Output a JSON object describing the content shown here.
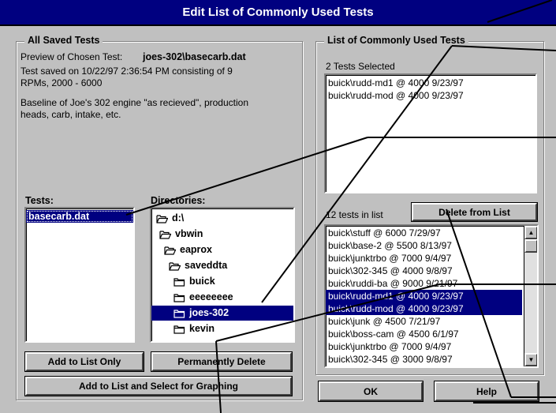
{
  "dialog": {
    "title": "Edit List of Commonly Used Tests"
  },
  "saved_tests": {
    "group_title": "All Saved Tests",
    "preview_prefix": "Preview of Chosen Test:",
    "preview_name": "joes-302\\basecarb.dat",
    "saved_line1": "Test saved on 10/22/97 2:36:54 PM consisting of 9",
    "saved_line2": "RPMs, 2000 - 6000",
    "desc_line1": "Baseline of Joe's 302 engine \"as recieved\", production",
    "desc_line2": "heads, carb, intake, etc.",
    "tests_label": "Tests:",
    "tests": [
      {
        "label": "basecarb.dat",
        "selected": true
      }
    ],
    "directories_label": "Directories:",
    "directories": [
      {
        "label": "d:\\",
        "icon": "folder-open-icon",
        "selected": false
      },
      {
        "label": "vbwin",
        "icon": "folder-open-icon",
        "selected": false
      },
      {
        "label": "eaprox",
        "icon": "folder-open-icon",
        "selected": false
      },
      {
        "label": "saveddta",
        "icon": "folder-open-icon",
        "selected": false
      },
      {
        "label": "buick",
        "icon": "folder-icon",
        "selected": false
      },
      {
        "label": "eeeeeeee",
        "icon": "folder-icon",
        "selected": false
      },
      {
        "label": "joes-302",
        "icon": "folder-icon",
        "selected": true
      },
      {
        "label": "kevin",
        "icon": "folder-icon",
        "selected": false
      }
    ],
    "add_only_label": "Add to List Only",
    "permanently_delete_label": "Permanently Delete",
    "add_select_label": "Add to List and Select for Graphing"
  },
  "common_tests": {
    "group_title": "List of Commonly Used Tests",
    "selected_count_text": "2 Tests Selected",
    "selected_items": [
      "buick\\rudd-md1 @ 4000 9/23/97",
      "buick\\rudd-mod @ 4000 9/23/97"
    ],
    "list_count_text": "12 tests in list",
    "delete_label": "Delete from List",
    "list_items": [
      {
        "label": "buick\\stuff @ 6000 7/29/97",
        "selected": false
      },
      {
        "label": "buick\\base-2 @ 5500 8/13/97",
        "selected": false
      },
      {
        "label": "buick\\junktrbo @ 7000 9/4/97",
        "selected": false
      },
      {
        "label": "buick\\302-345 @ 4000 9/8/97",
        "selected": false
      },
      {
        "label": "buick\\ruddi-ba @ 9000 9/21/97",
        "selected": false
      },
      {
        "label": "buick\\rudd-md1 @ 4000 9/23/97",
        "selected": true
      },
      {
        "label": "buick\\rudd-mod @ 4000 9/23/97",
        "selected": true
      },
      {
        "label": "buick\\junk @ 4500 7/21/97",
        "selected": false
      },
      {
        "label": "buick\\boss-cam @ 4500 6/1/97",
        "selected": false
      },
      {
        "label": "buick\\junktrbo @ 7000 9/4/97",
        "selected": false
      },
      {
        "label": "buick\\302-345 @ 3000 9/8/97",
        "selected": false
      }
    ],
    "scroll_fraction": 0.0
  },
  "footer": {
    "ok_label": "OK",
    "help_label": "Help"
  },
  "colors": {
    "titlebar": "#000080",
    "selection": "#000080",
    "face": "#c0c0c0"
  }
}
